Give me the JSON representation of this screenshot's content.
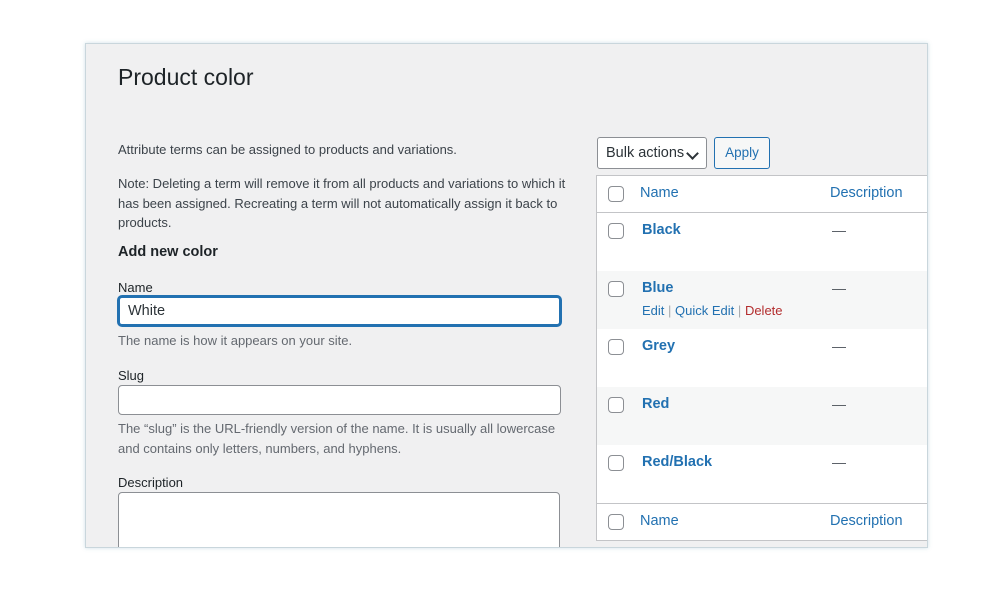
{
  "page": {
    "title": "Product color",
    "intro": "Attribute terms can be assigned to products and variations.",
    "note": "Note: Deleting a term will remove it from all products and variations to which it has been assigned. Recreating a term will not automatically assign it back to products."
  },
  "form": {
    "heading": "Add new color",
    "name_label": "Name",
    "name_value": "White",
    "name_help": "The name is how it appears on your site.",
    "slug_label": "Slug",
    "slug_value": "",
    "slug_help": "The “slug” is the URL-friendly version of the name. It is usually all lowercase and contains only letters, numbers, and hyphens.",
    "description_label": "Description",
    "description_value": ""
  },
  "toolbar": {
    "bulk_actions": "Bulk actions",
    "apply": "Apply"
  },
  "table": {
    "columns": {
      "name": "Name",
      "description": "Description"
    },
    "rows": [
      {
        "name": "Black",
        "description": "—"
      },
      {
        "name": "Blue",
        "description": "—",
        "actions": {
          "edit": "Edit",
          "sep1": "|",
          "quick_edit": "Quick Edit",
          "sep2": "|",
          "delete": "Delete"
        }
      },
      {
        "name": "Grey",
        "description": "—"
      },
      {
        "name": "Red",
        "description": "—"
      },
      {
        "name": "Red/Black",
        "description": "—"
      }
    ]
  },
  "colors": {
    "link": "#2271b1",
    "delete": "#b32d2e",
    "focus": "#2271b1"
  }
}
